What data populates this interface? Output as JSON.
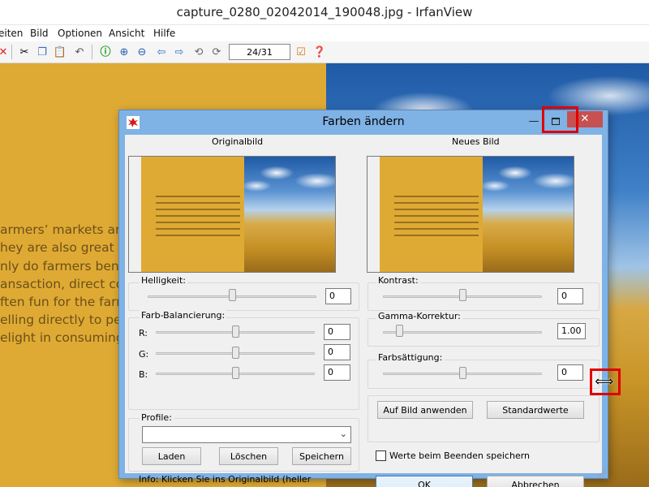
{
  "window": {
    "title": "capture_0280_02042014_190048.jpg - IrfanView"
  },
  "menu": [
    "eiten",
    "Bild",
    "Optionen",
    "Ansicht",
    "Hilfe"
  ],
  "toolbar": {
    "page_indicator": "24/31"
  },
  "background_text": [
    "armers’ markets are g",
    "hey are also great for",
    "nly do farmers benefi",
    "ansaction, direct cont",
    "ften fun for the farme",
    "elling directly to peop",
    "elight in consuming t"
  ],
  "dialog": {
    "title": "Farben ändern",
    "original_label": "Originalbild",
    "new_label": "Neues Bild",
    "brightness": {
      "label": "Helligkeit:",
      "value": "0",
      "level": 0.5
    },
    "color_balance": {
      "label": "Farb-Balancierung:",
      "r": {
        "label": "R:",
        "value": "0",
        "level": 0.5
      },
      "g": {
        "label": "G:",
        "value": "0",
        "level": 0.5
      },
      "b": {
        "label": "B:",
        "value": "0",
        "level": 0.5
      }
    },
    "contrast": {
      "label": "Kontrast:",
      "value": "0",
      "level": 0.5
    },
    "gamma": {
      "label": "Gamma-Korrektur:",
      "value": "1.00",
      "level": 0.1
    },
    "saturation": {
      "label": "Farbsättigung:",
      "value": "0",
      "level": 0.5
    },
    "profiles": {
      "label": "Profile:",
      "selected": "",
      "load": "Laden",
      "delete": "Löschen",
      "save": "Speichern"
    },
    "info": "Info: Klicken Sie ins Originalbild (heller Bereich) um Weißabgleich zu ändern (RGB-Werte)",
    "apply": "Auf Bild anwenden",
    "defaults": "Standardwerte",
    "remember_checkbox": {
      "label": "Werte beim Beenden speichern",
      "checked": false
    },
    "ok": "OK",
    "cancel": "Abbrechen"
  },
  "colors": {
    "dialog_frame": "#7fb2e5",
    "close_button": "#c75050",
    "highlight": "#e00000",
    "image_yellow": "#dfaa34"
  }
}
